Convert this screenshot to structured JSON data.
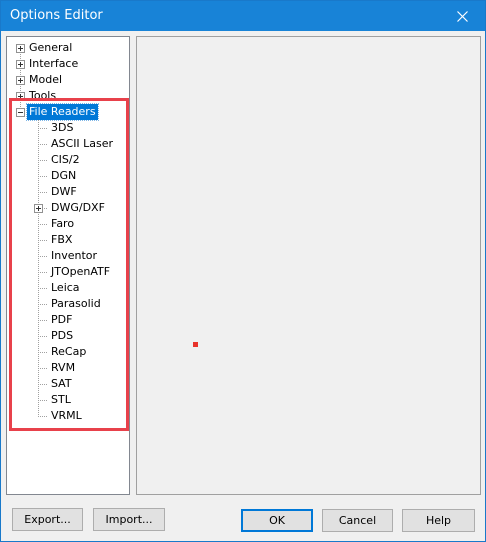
{
  "window": {
    "title": "Options Editor"
  },
  "tree": {
    "top_items": [
      {
        "label": "General",
        "expandable": true
      },
      {
        "label": "Interface",
        "expandable": true
      },
      {
        "label": "Model",
        "expandable": true
      },
      {
        "label": "Tools",
        "expandable": true
      }
    ],
    "selected": {
      "label": "File Readers",
      "expanded": true
    },
    "children": [
      {
        "label": "3DS",
        "expandable": false
      },
      {
        "label": "ASCII Laser",
        "expandable": false
      },
      {
        "label": "CIS/2",
        "expandable": false
      },
      {
        "label": "DGN",
        "expandable": false
      },
      {
        "label": "DWF",
        "expandable": false
      },
      {
        "label": "DWG/DXF",
        "expandable": true
      },
      {
        "label": "Faro",
        "expandable": false
      },
      {
        "label": "FBX",
        "expandable": false
      },
      {
        "label": "Inventor",
        "expandable": false
      },
      {
        "label": "JTOpenATF",
        "expandable": false
      },
      {
        "label": "Leica",
        "expandable": false
      },
      {
        "label": "Parasolid",
        "expandable": false
      },
      {
        "label": "PDF",
        "expandable": false
      },
      {
        "label": "PDS",
        "expandable": false
      },
      {
        "label": "ReCap",
        "expandable": false
      },
      {
        "label": "RVM",
        "expandable": false
      },
      {
        "label": "SAT",
        "expandable": false
      },
      {
        "label": "STL",
        "expandable": false
      },
      {
        "label": "VRML",
        "expandable": false
      }
    ]
  },
  "buttons": {
    "export": "Export...",
    "import": "Import...",
    "ok": "OK",
    "cancel": "Cancel",
    "help": "Help"
  },
  "icons": {
    "close": "close-icon",
    "expand": "plus-box-icon",
    "collapse": "minus-box-icon"
  },
  "colors": {
    "titlebar": "#1883d7",
    "selection": "#0078d7",
    "highlight_box": "#e8414b",
    "marker": "#e8322b"
  }
}
